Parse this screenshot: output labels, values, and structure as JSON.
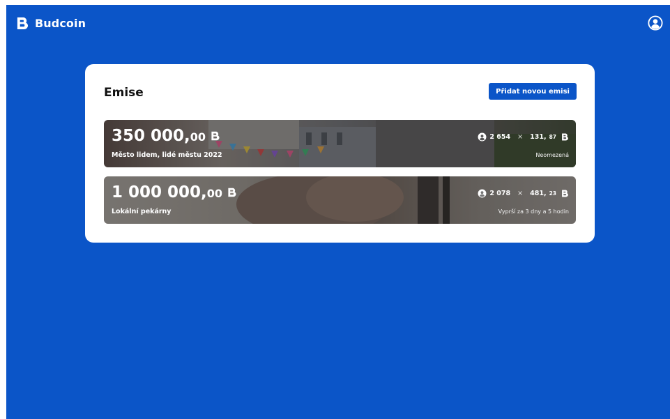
{
  "app": {
    "name": "Budcoin",
    "logo_icon": "budcoin-logo-icon",
    "background": "#0b55c8"
  },
  "header": {
    "profile_icon": "user-circle-icon"
  },
  "main": {
    "title": "Emise",
    "add_button_label": "Přidat novou emisi",
    "emissions": [
      {
        "amount_int": "350 000,",
        "amount_dec": "00",
        "name": "Město lidem, lidé městu 2022",
        "participants": "2 654",
        "times": "×",
        "per_int": "131,",
        "per_dec": "87",
        "validity": "Neomezená"
      },
      {
        "amount_int": "1 000 000,",
        "amount_dec": "00",
        "name": "Lokální pekárny",
        "participants": "2 078",
        "times": "×",
        "per_int": "481,",
        "per_dec": "23",
        "validity": "Vyprší za 3 dny a 5 hodin"
      }
    ]
  }
}
